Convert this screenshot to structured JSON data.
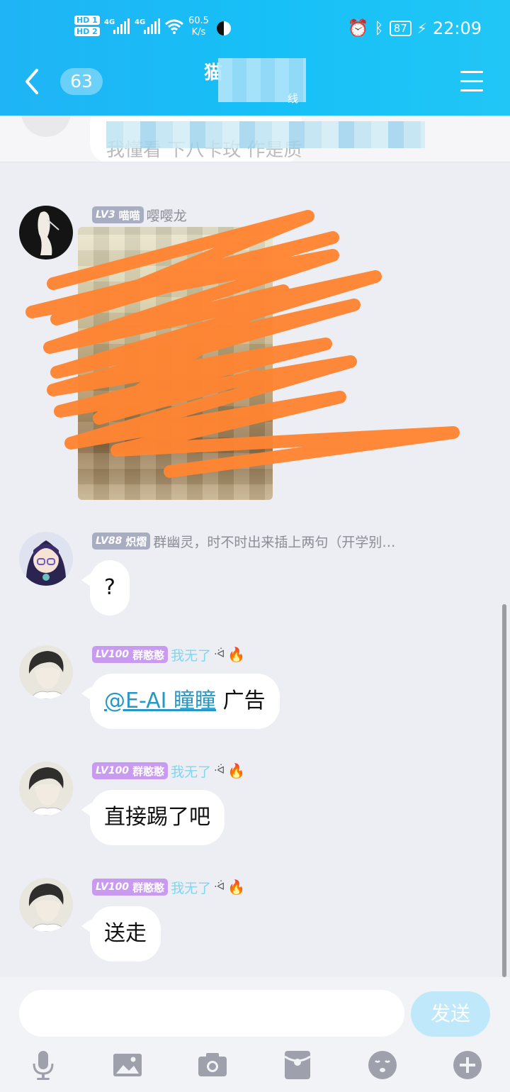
{
  "status_bar": {
    "hd1": "HD 1",
    "hd2": "HD 2",
    "net1": "4G",
    "net2": "4G",
    "speed_value": "60.5",
    "speed_unit": "K/s",
    "battery": "87",
    "time": "22:09"
  },
  "header": {
    "unread_count": "63",
    "title_visible": "猫",
    "subtitle_fragment": "线"
  },
  "pinned": {
    "text_fragment": "我懂看  下八卡玫   作是质"
  },
  "messages": [
    {
      "level": "LV3",
      "name": "喵喵",
      "title": "嘤嘤龙",
      "type": "image"
    },
    {
      "level": "LV88",
      "name": "炽熠",
      "title": "群幽灵，时不时出来插上两句（开学别…",
      "text": "?"
    },
    {
      "level": "LV100",
      "name": "群憨憨",
      "title": "我无了",
      "mention": "@E-AI 瞳瞳",
      "text": " 广告"
    },
    {
      "level": "LV100",
      "name": "群憨憨",
      "title": "我无了",
      "text": "直接踢了吧"
    },
    {
      "level": "LV100",
      "name": "群憨憨",
      "title": "我无了",
      "text": "送走"
    }
  ],
  "input": {
    "value": "",
    "send_label": "发送"
  },
  "colors": {
    "header": "#1fb4f5",
    "level_gray": "#a9adc2",
    "level_purple": "#c99bf0",
    "mention": "#2797c8",
    "scribble": "#ff8533"
  }
}
